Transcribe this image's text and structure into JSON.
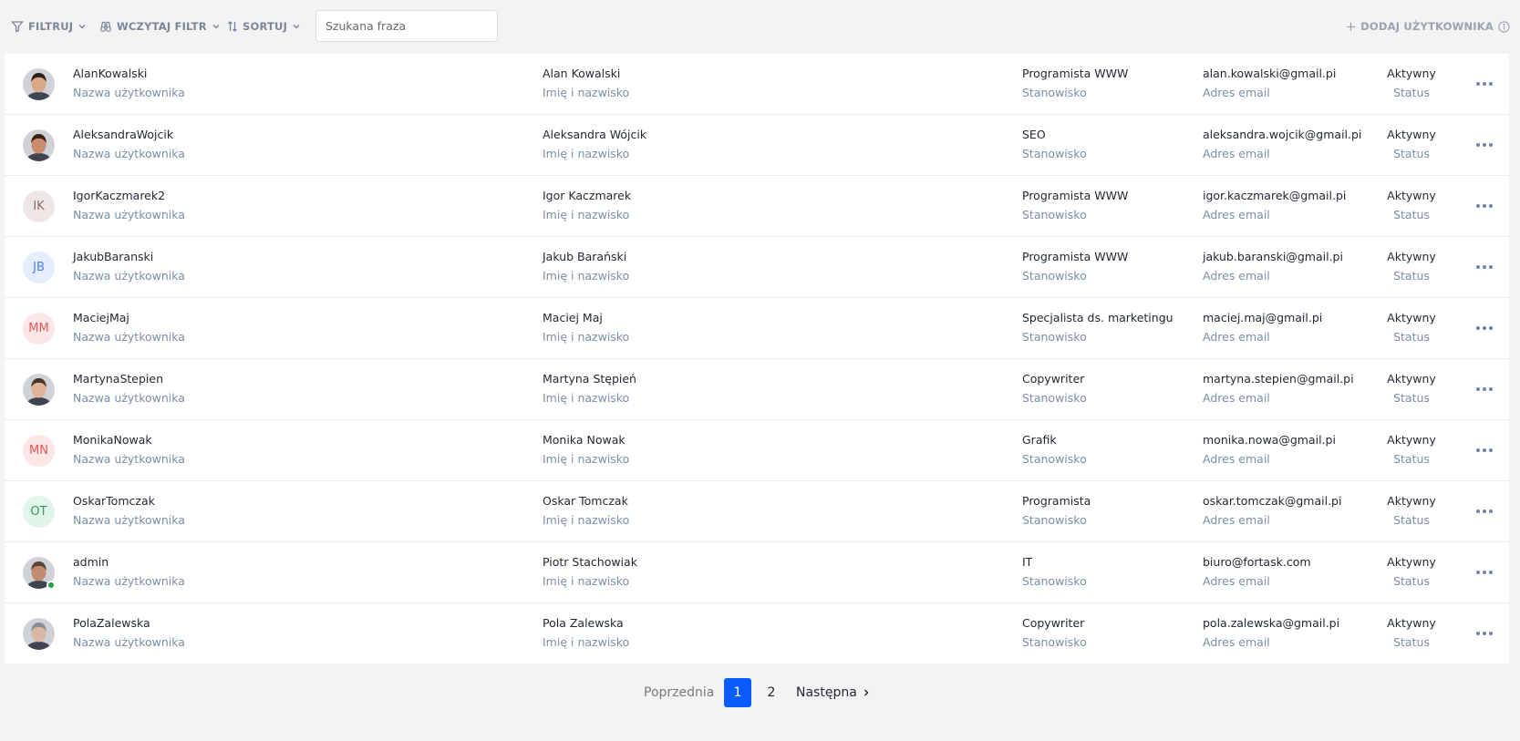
{
  "toolbar": {
    "filter_label": "FILTRUJ",
    "load_filter_label": "WCZYTAJ FILTR",
    "sort_label": "SORTUJ",
    "search_placeholder": "Szukana fraza",
    "add_user_label": "DODAJ UŻYTKOWNIKA"
  },
  "columns": {
    "username": "Nazwa użytkownika",
    "fullname": "Imię i nazwisko",
    "position": "Stanowisko",
    "email": "Adres email",
    "status": "Status"
  },
  "users": [
    {
      "username": "AlanKowalski",
      "fullname": "Alan Kowalski",
      "position": "Programista WWW",
      "email": "alan.kowalski@gmail.pi",
      "status": "Aktywny",
      "avatar": "photo"
    },
    {
      "username": "AleksandraWojcik",
      "fullname": "Aleksandra Wójcik",
      "position": "SEO",
      "email": "aleksandra.wojcik@gmail.pi",
      "status": "Aktywny",
      "avatar": "photo"
    },
    {
      "username": "IgorKaczmarek2",
      "fullname": "Igor Kaczmarek",
      "position": "Programista WWW",
      "email": "igor.kaczmarek@gmail.pi",
      "status": "Aktywny",
      "initials": "IK",
      "avatar_bg": "#efe7e5",
      "avatar_fg": "#8a6c64"
    },
    {
      "username": "JakubBaranski",
      "fullname": "Jakub Barański",
      "position": "Programista WWW",
      "email": "jakub.baranski@gmail.pi",
      "status": "Aktywny",
      "initials": "JB",
      "avatar_bg": "#e4eefe",
      "avatar_fg": "#4d7fe0"
    },
    {
      "username": "MaciejMaj",
      "fullname": "Maciej Maj",
      "position": "Specjalista ds. marketingu",
      "email": "maciej.maj@gmail.pi",
      "status": "Aktywny",
      "initials": "MM",
      "avatar_bg": "#fde6e6",
      "avatar_fg": "#e05858"
    },
    {
      "username": "MartynaStepien",
      "fullname": "Martyna Stępień",
      "position": "Copywriter",
      "email": "martyna.stepien@gmail.pi",
      "status": "Aktywny",
      "avatar": "photo"
    },
    {
      "username": "MonikaNowak",
      "fullname": "Monika Nowak",
      "position": "Grafik",
      "email": "monika.nowa@gmail.pi",
      "status": "Aktywny",
      "initials": "MN",
      "avatar_bg": "#fde6e6",
      "avatar_fg": "#e05858"
    },
    {
      "username": "OskarTomczak",
      "fullname": "Oskar Tomczak",
      "position": "Programista",
      "email": "oskar.tomczak@gmail.pi",
      "status": "Aktywny",
      "initials": "OT",
      "avatar_bg": "#e2f5ea",
      "avatar_fg": "#2e9b5a"
    },
    {
      "username": "admin",
      "fullname": "Piotr Stachowiak",
      "position": "IT",
      "email": "biuro@fortask.com",
      "status": "Aktywny",
      "avatar": "photo",
      "online": true
    },
    {
      "username": "PolaZalewska",
      "fullname": "Pola Zalewska",
      "position": "Copywriter",
      "email": "pola.zalewska@gmail.pi",
      "status": "Aktywny",
      "avatar": "photo"
    }
  ],
  "pagination": {
    "prev_label": "Poprzednia",
    "pages": [
      "1",
      "2"
    ],
    "current_page": "1",
    "next_label": "Następna"
  },
  "colors": {
    "accent": "#0a5cff",
    "label_text": "#7a8fa8",
    "online": "#22a34a"
  }
}
